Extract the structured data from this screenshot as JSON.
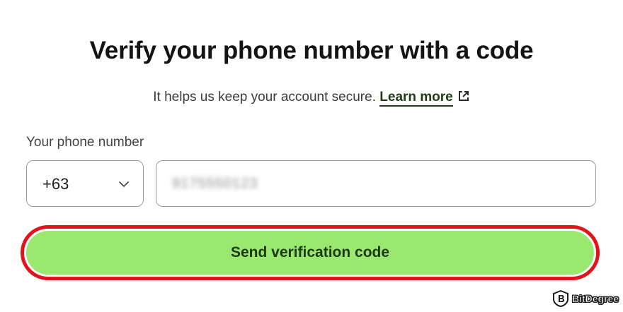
{
  "heading": {
    "title": "Verify your phone number with a code",
    "subtitle": "It helps us keep your account secure.",
    "learn_more": "Learn more"
  },
  "form": {
    "phone_label": "Your phone number",
    "country_code": "+63",
    "phone_value": "9175550123"
  },
  "actions": {
    "send_label": "Send verification code"
  },
  "watermark": {
    "brand": "BitDegree"
  },
  "colors": {
    "button_bg": "#9be870",
    "button_text": "#1c3a12",
    "highlight": "#e2131a",
    "link": "#1f3b17"
  }
}
